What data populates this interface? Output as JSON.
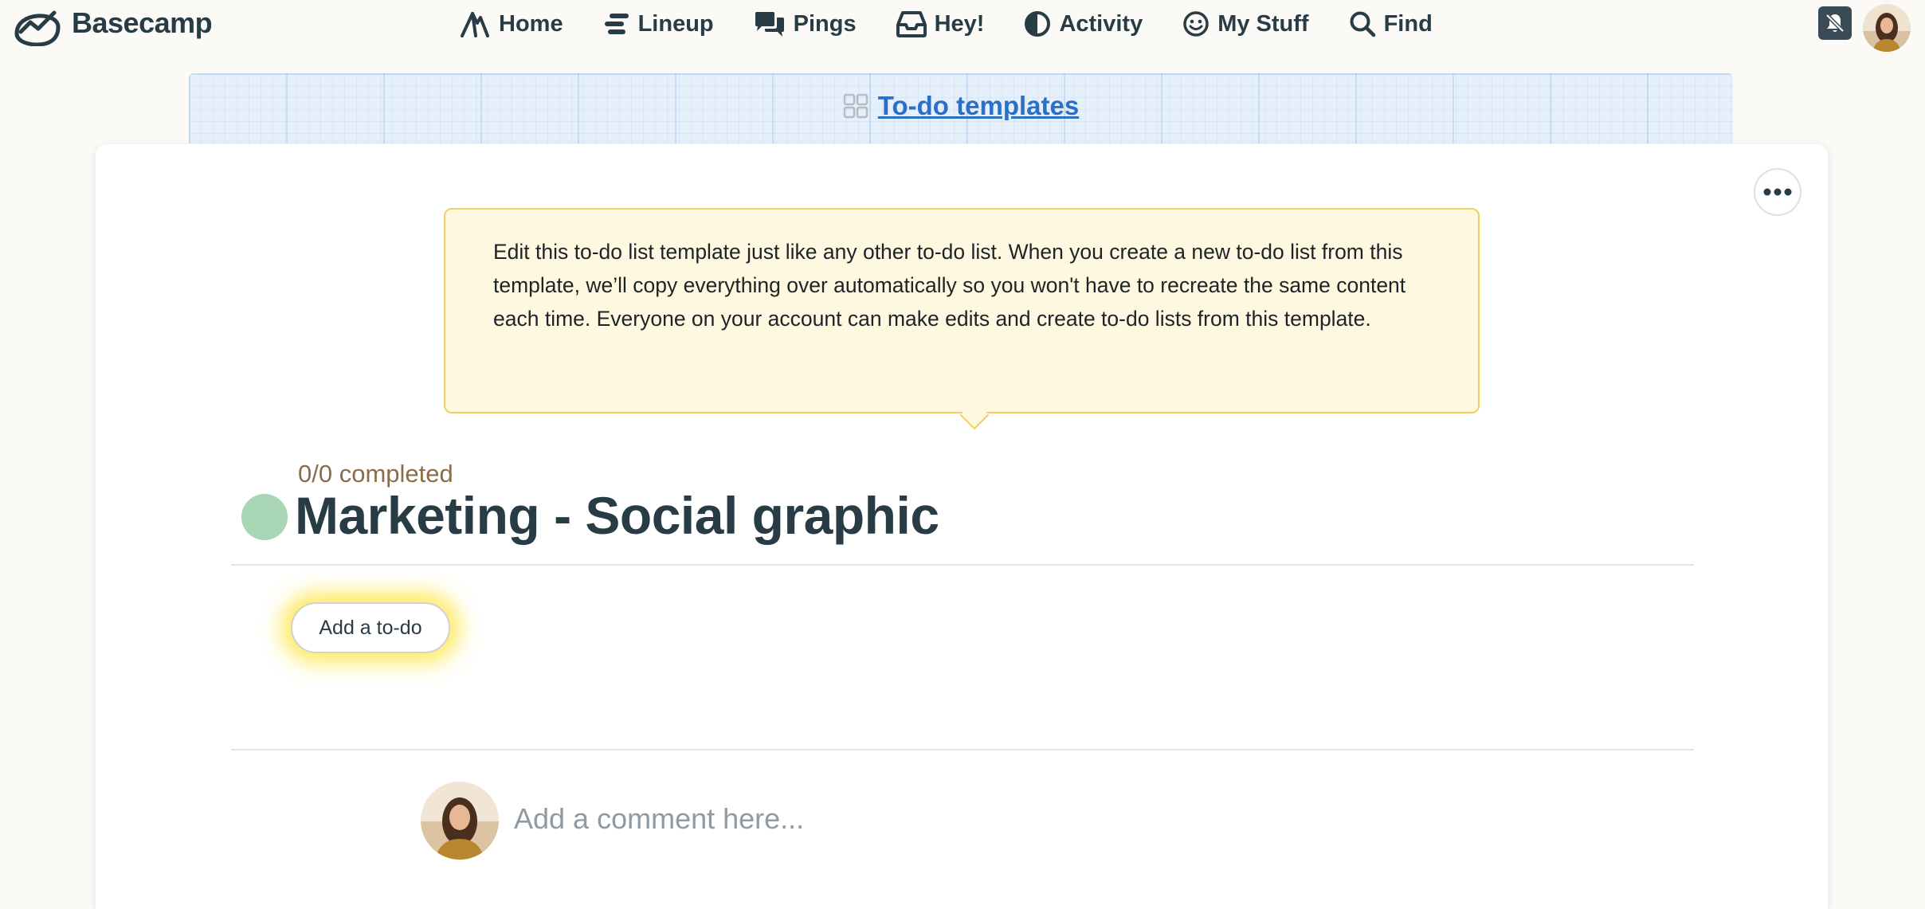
{
  "brand": {
    "name": "Basecamp"
  },
  "nav": {
    "items": [
      {
        "label": "Home",
        "icon": "home-icon"
      },
      {
        "label": "Lineup",
        "icon": "lineup-icon"
      },
      {
        "label": "Pings",
        "icon": "pings-icon"
      },
      {
        "label": "Hey!",
        "icon": "inbox-icon"
      },
      {
        "label": "Activity",
        "icon": "activity-icon"
      },
      {
        "label": "My Stuff",
        "icon": "smiley-icon"
      },
      {
        "label": "Find",
        "icon": "search-icon"
      }
    ],
    "notifications_icon": "bell-muted-icon"
  },
  "breadcrumb": {
    "label": "To-do templates",
    "icon": "templates-icon"
  },
  "notice": {
    "text": "Edit this to-do list template just like any other to-do list. When you create a new to-do list from this template, we’ll copy everything over automatically so you won't have to recreate the same content each time. Everyone on your account can make edits and create to-do lists from this template."
  },
  "todolist": {
    "completed": "0/0 completed",
    "title": "Marketing - Social graphic",
    "status_color": "#a8d6b4",
    "add_todo_label": "Add a to-do"
  },
  "comment": {
    "placeholder": "Add a comment here..."
  },
  "colors": {
    "link": "#2a6fc8",
    "text": "#283c46",
    "highlight": "#ffe228",
    "notice_bg": "#fff8e1",
    "notice_border": "#f1cd63"
  }
}
